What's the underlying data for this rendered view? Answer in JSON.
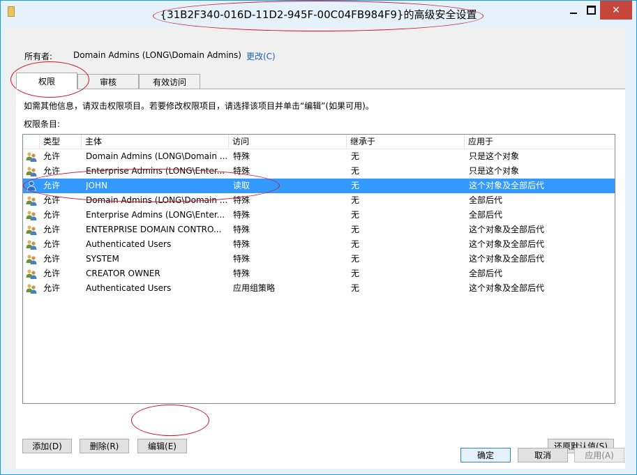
{
  "window": {
    "title": "{31B2F340-016D-11D2-945F-00C04FB984F9}的高级安全设置",
    "controls": {
      "minimize": "—",
      "close": "✕"
    }
  },
  "owner": {
    "label": "所有者:",
    "value": "Domain Admins (LONG\\Domain Admins)",
    "change": "更改(C)"
  },
  "tabs": [
    "权限",
    "审核",
    "有效访问"
  ],
  "panel": {
    "info": "如需其他信息，请双击权限项目。若要修改权限项目，请选择该项目并单击“编辑”(如果可用)。",
    "entries_label": "权限条目:"
  },
  "columns": [
    "类型",
    "主体",
    "访问",
    "继承于",
    "应用于"
  ],
  "rows": [
    {
      "type": "允许",
      "principal": "Domain Admins (LONG\\Domain ...",
      "access": "特殊",
      "inherited": "无",
      "applies": "只是这个对象",
      "icon": "group-users-icon"
    },
    {
      "type": "允许",
      "principal": "Enterprise Admins (LONG\\Enter...",
      "access": "特殊",
      "inherited": "无",
      "applies": "只是这个对象",
      "icon": "group-users-icon"
    },
    {
      "type": "允许",
      "principal": "JOHN",
      "access": "读取",
      "inherited": "无",
      "applies": "这个对象及全部后代",
      "icon": "user-icon"
    },
    {
      "type": "允许",
      "principal": "Domain Admins (LONG\\Domain ...",
      "access": "特殊",
      "inherited": "无",
      "applies": "全部后代",
      "icon": "group-users-icon"
    },
    {
      "type": "允许",
      "principal": "Enterprise Admins (LONG\\Enter...",
      "access": "特殊",
      "inherited": "无",
      "applies": "全部后代",
      "icon": "group-users-icon"
    },
    {
      "type": "允许",
      "principal": "ENTERPRISE DOMAIN CONTRO...",
      "access": "特殊",
      "inherited": "无",
      "applies": "这个对象及全部后代",
      "icon": "group-users-icon"
    },
    {
      "type": "允许",
      "principal": "Authenticated Users",
      "access": "特殊",
      "inherited": "无",
      "applies": "这个对象及全部后代",
      "icon": "group-users-icon"
    },
    {
      "type": "允许",
      "principal": "SYSTEM",
      "access": "特殊",
      "inherited": "无",
      "applies": "这个对象及全部后代",
      "icon": "group-users-icon"
    },
    {
      "type": "允许",
      "principal": "CREATOR OWNER",
      "access": "特殊",
      "inherited": "无",
      "applies": "全部后代",
      "icon": "group-users-icon"
    },
    {
      "type": "允许",
      "principal": "Authenticated Users",
      "access": "应用组策略",
      "inherited": "无",
      "applies": "这个对象及全部后代",
      "icon": "group-users-icon"
    }
  ],
  "buttons": {
    "add": "添加(D)",
    "remove": "删除(R)",
    "edit": "编辑(E)",
    "restore": "还原默认值(S)",
    "ok": "确定",
    "cancel": "取消",
    "apply": "应用(A)"
  },
  "colors": {
    "selection": "#3399ff",
    "annotation": "#d0112b",
    "close": "#c7463c"
  }
}
